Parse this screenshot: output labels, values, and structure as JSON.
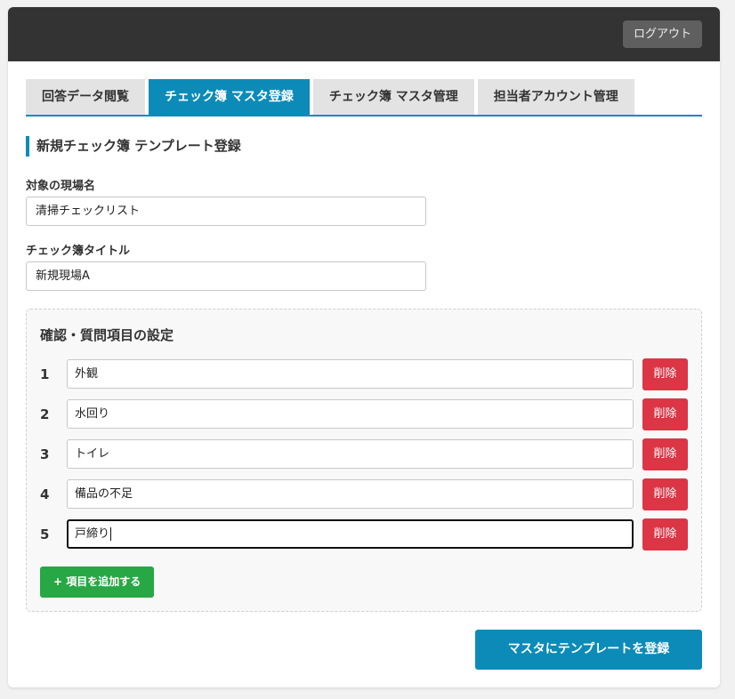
{
  "header": {
    "logout_label": "ログアウト"
  },
  "tabs": [
    {
      "label": "回答データ閲覧",
      "active": false
    },
    {
      "label": "チェック簿 マスタ登録",
      "active": true
    },
    {
      "label": "チェック簿 マスタ管理",
      "active": false
    },
    {
      "label": "担当者アカウント管理",
      "active": false
    }
  ],
  "form": {
    "section_title": "新規チェック簿 テンプレート登録",
    "site_name": {
      "label": "対象の現場名",
      "value": "清掃チェックリスト"
    },
    "book_title": {
      "label": "チェック簿タイトル",
      "value": "新規現場A"
    }
  },
  "items_section": {
    "title": "確認・質問項目の設定",
    "items": [
      {
        "number": "1",
        "value": "外観",
        "delete_label": "削除",
        "focused": false
      },
      {
        "number": "2",
        "value": "水回り",
        "delete_label": "削除",
        "focused": false
      },
      {
        "number": "3",
        "value": "トイレ",
        "delete_label": "削除",
        "focused": false
      },
      {
        "number": "4",
        "value": "備品の不足",
        "delete_label": "削除",
        "focused": false
      },
      {
        "number": "5",
        "value": "戸締り",
        "delete_label": "削除",
        "focused": true
      }
    ],
    "add_label": "+ 項目を追加する"
  },
  "submit_label": "マスタにテンプレートを登録",
  "colors": {
    "primary": "#0c8bb8",
    "danger": "#dc3545",
    "success": "#28a745",
    "topbar": "#333333"
  }
}
